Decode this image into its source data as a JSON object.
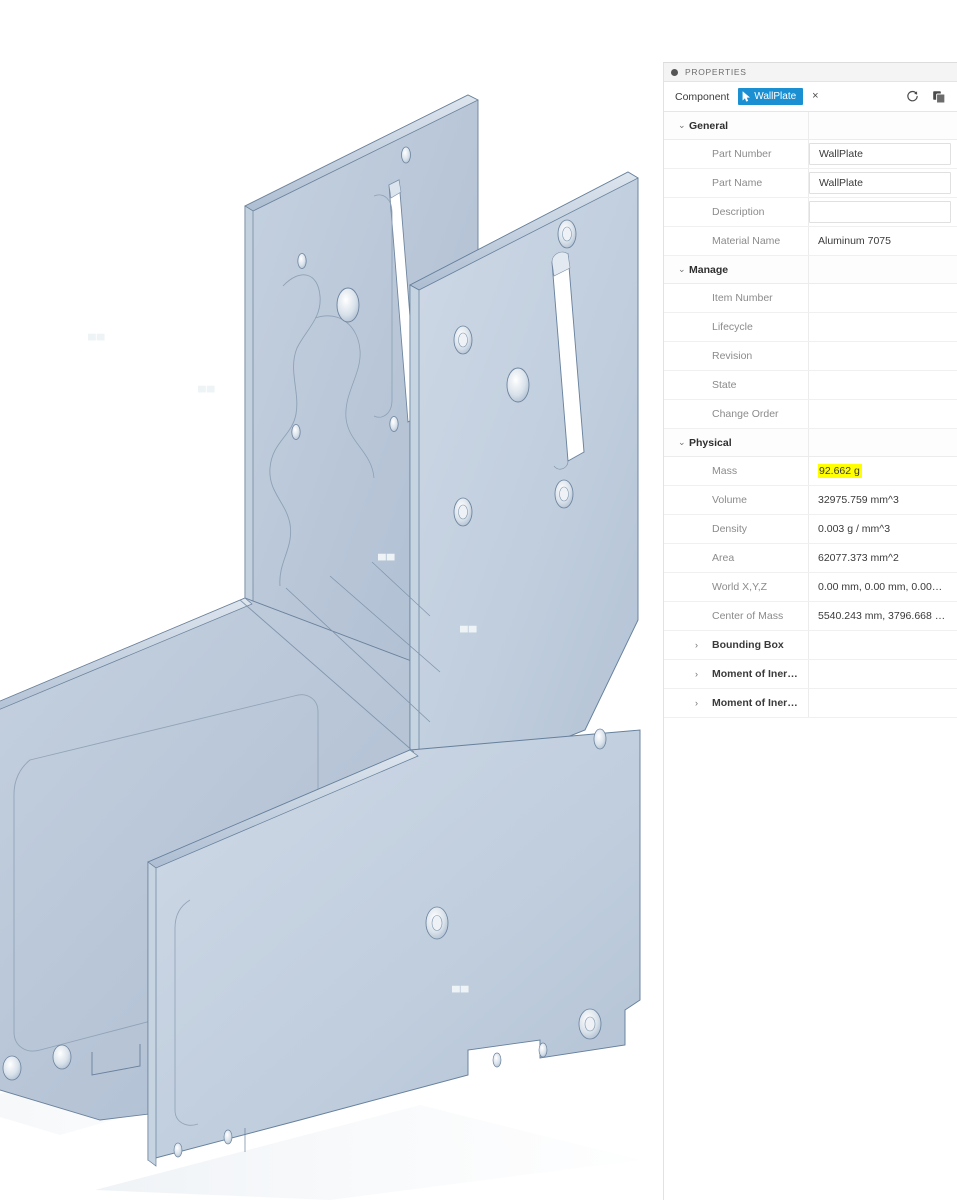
{
  "panel": {
    "title": "PROPERTIES",
    "title_dot_icon": "filled-circle-icon",
    "selection_label": "Component",
    "chip_label": "WallPlate",
    "chip_icon": "cursor-arrow-icon",
    "chip_close_label": "×",
    "refresh_icon": "refresh-icon",
    "copy_icon": "copy-icon",
    "accent_color": "#1a8fd1",
    "highlight_color": "#ffff00"
  },
  "groups": [
    {
      "name": "General",
      "expanded": true,
      "caret": "⌄",
      "rows": [
        {
          "key": "Part Number",
          "value": "WallPlate",
          "boxed": true,
          "highlight": false
        },
        {
          "key": "Part Name",
          "value": "WallPlate",
          "boxed": true,
          "highlight": false
        },
        {
          "key": "Description",
          "value": "",
          "boxed": true,
          "highlight": false
        },
        {
          "key": "Material Name",
          "value": "Aluminum 7075",
          "boxed": false,
          "highlight": false
        }
      ]
    },
    {
      "name": "Manage",
      "expanded": true,
      "caret": "⌄",
      "rows": [
        {
          "key": "Item Number",
          "value": "",
          "boxed": false,
          "highlight": false
        },
        {
          "key": "Lifecycle",
          "value": "",
          "boxed": false,
          "highlight": false
        },
        {
          "key": "Revision",
          "value": "",
          "boxed": false,
          "highlight": false
        },
        {
          "key": "State",
          "value": "",
          "boxed": false,
          "highlight": false
        },
        {
          "key": "Change Order",
          "value": "",
          "boxed": false,
          "highlight": false
        }
      ]
    },
    {
      "name": "Physical",
      "expanded": true,
      "caret": "⌄",
      "rows": [
        {
          "key": "Mass",
          "value": "92.662 g",
          "boxed": false,
          "highlight": true
        },
        {
          "key": "Volume",
          "value": "32975.759 mm^3",
          "boxed": false,
          "highlight": false
        },
        {
          "key": "Density",
          "value": "0.003 g / mm^3",
          "boxed": false,
          "highlight": false
        },
        {
          "key": "Area",
          "value": "62077.373 mm^2",
          "boxed": false,
          "highlight": false
        },
        {
          "key": "World X,Y,Z",
          "value": "0.00 mm, 0.00 mm, 0.00…",
          "boxed": false,
          "highlight": false
        },
        {
          "key": "Center of Mass",
          "value": "5540.243 mm, 3796.668 …",
          "boxed": false,
          "highlight": false
        }
      ]
    }
  ],
  "collapsed_groups": [
    {
      "name": "Bounding Box",
      "caret": "›",
      "expanded": false
    },
    {
      "name": "Moment of Iner…",
      "caret": "›",
      "expanded": false
    },
    {
      "name": "Moment of Iner…",
      "caret": "›",
      "expanded": false
    }
  ],
  "viewport": {
    "model_name": "WallPlate",
    "body_fill": "#b9c7d9",
    "body_fill_light": "#c9d5e3",
    "edge_color": "#5d7490",
    "background": "#ffffff",
    "watermarks": [
      "▄▄",
      "▄▄",
      "▄▄",
      "▄▄",
      "▄▄"
    ]
  }
}
